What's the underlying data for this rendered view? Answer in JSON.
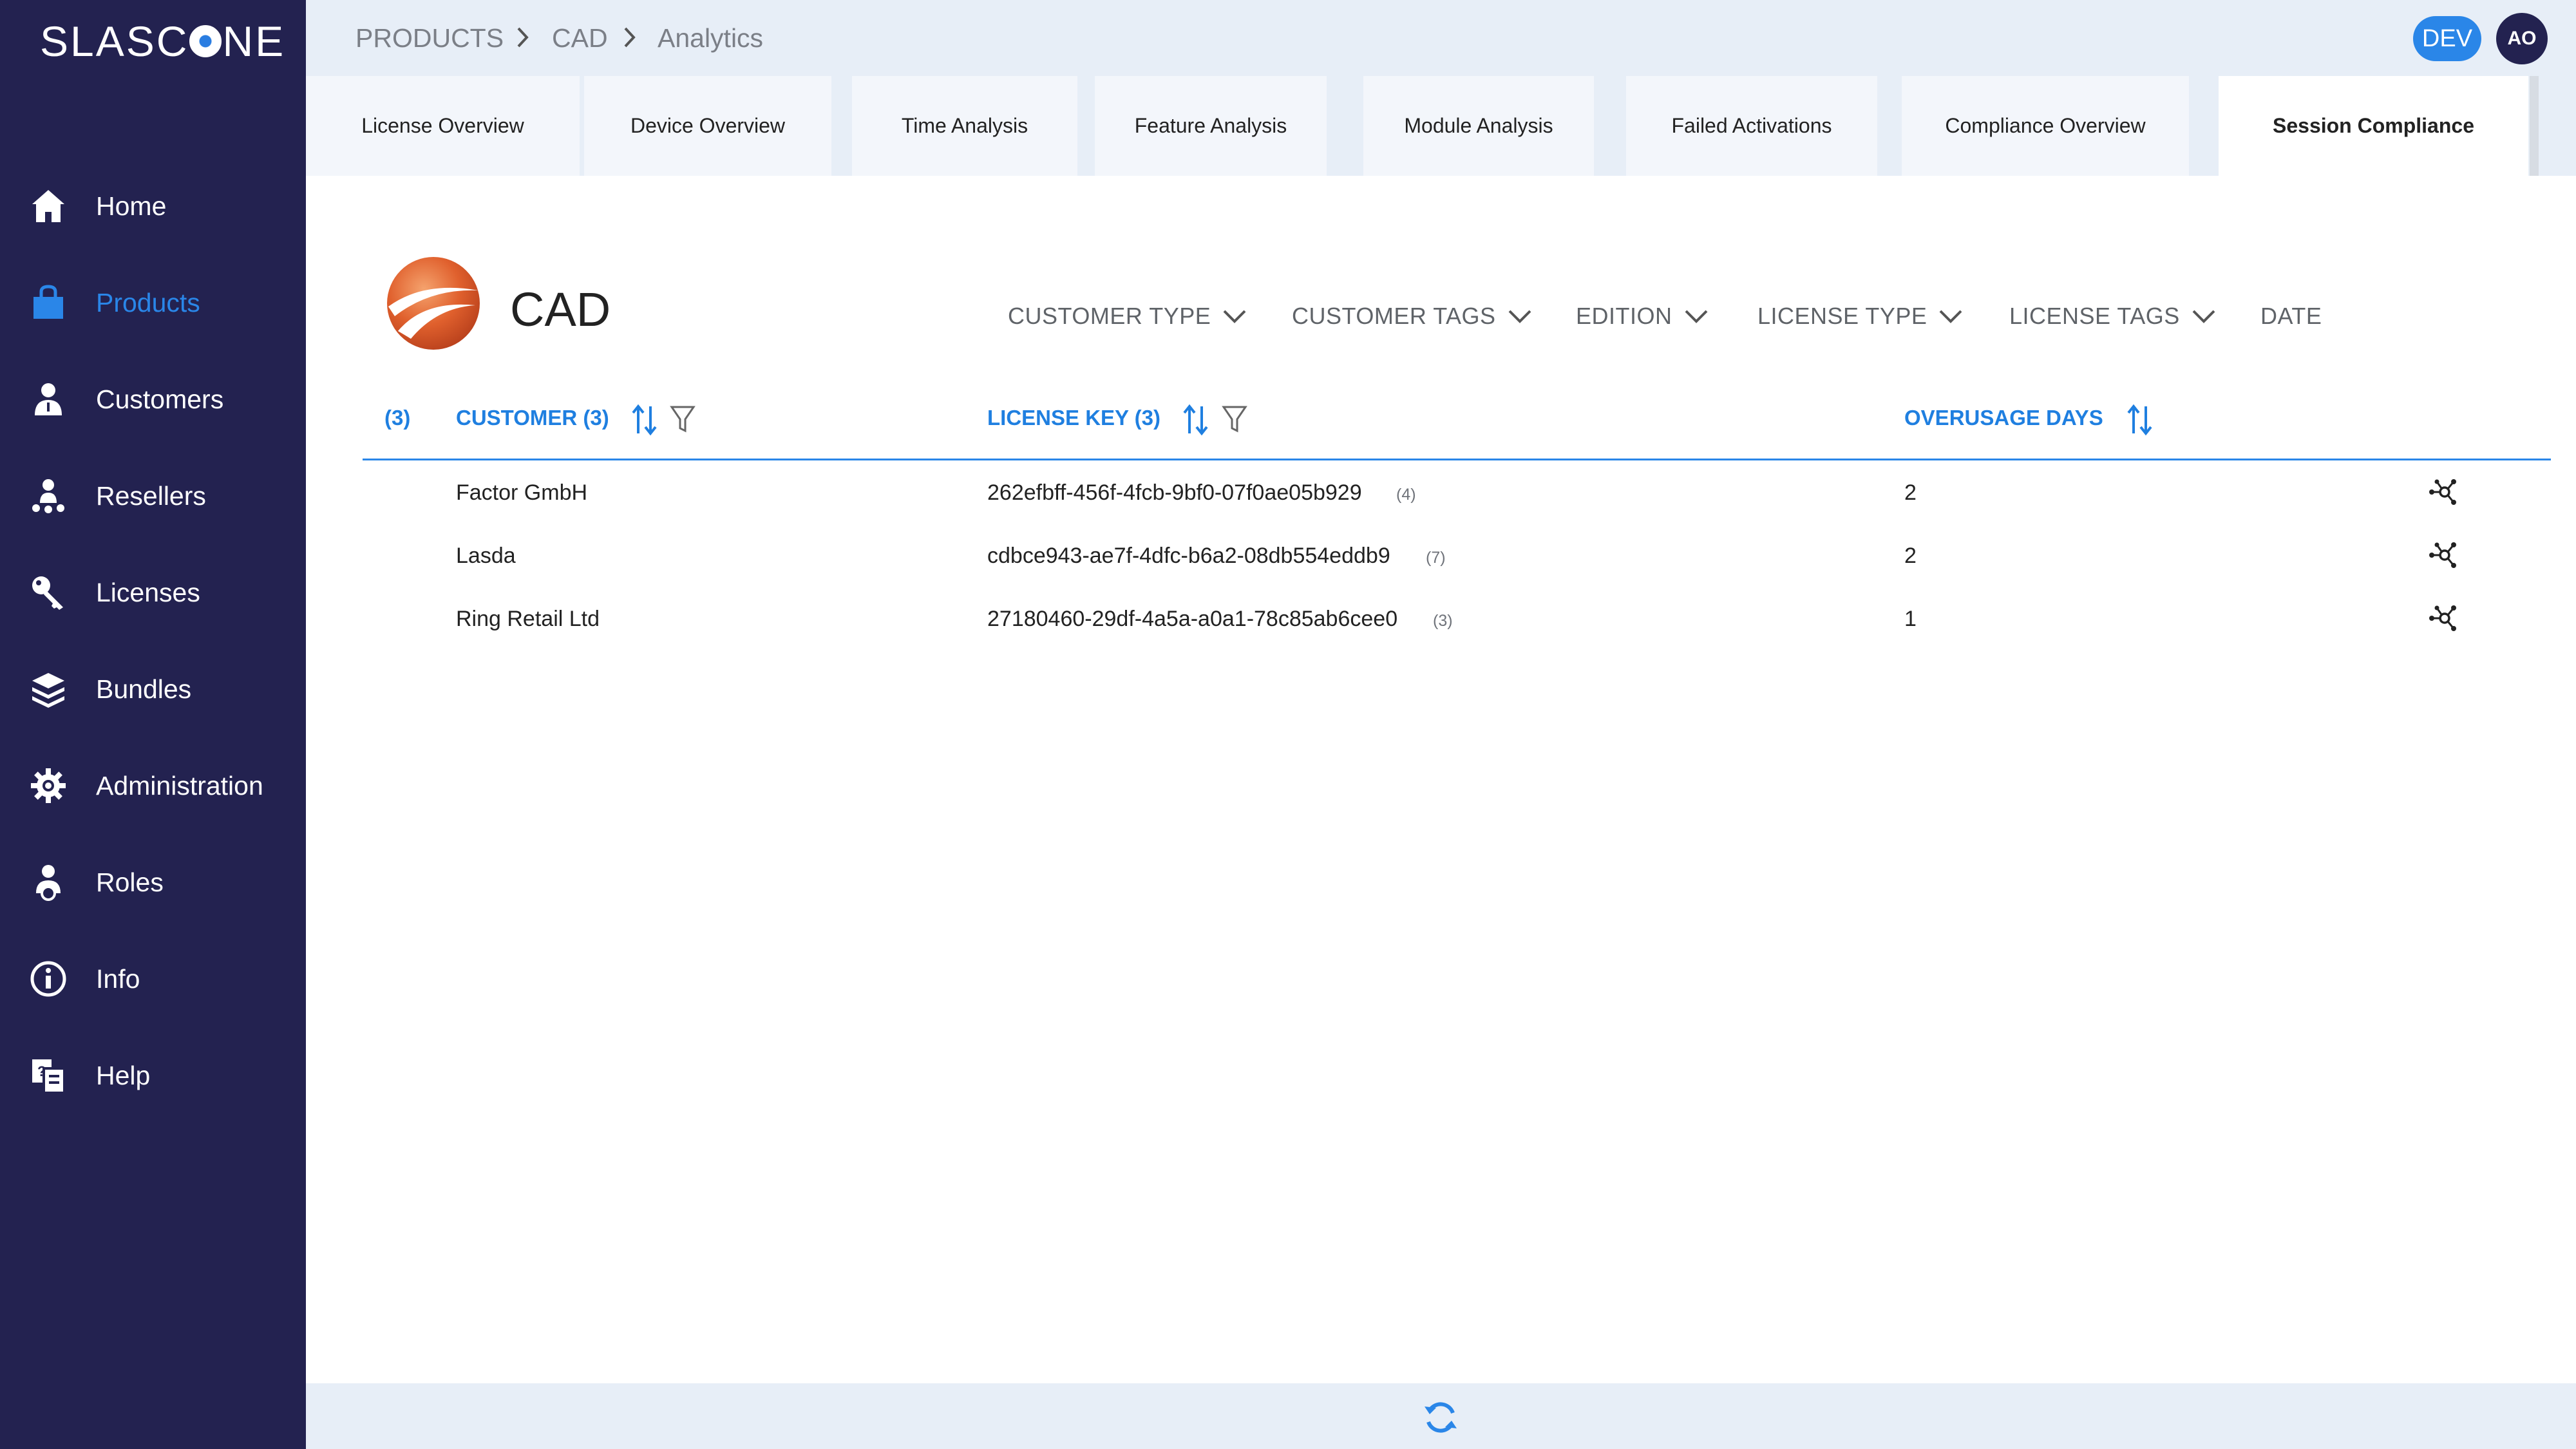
{
  "app": {
    "logo_text_left": "SLASC",
    "logo_text_right": "NE",
    "accent_color": "#2a86e8",
    "sidebar_color": "#232250"
  },
  "sidebar": {
    "items": [
      {
        "label": "Home",
        "icon": "home-icon"
      },
      {
        "label": "Products",
        "icon": "shopping-bag-icon",
        "active": true
      },
      {
        "label": "Customers",
        "icon": "customer-icon"
      },
      {
        "label": "Resellers",
        "icon": "reseller-icon"
      },
      {
        "label": "Licenses",
        "icon": "key-icon"
      },
      {
        "label": "Bundles",
        "icon": "bundles-icon"
      },
      {
        "label": "Administration",
        "icon": "gear-icon"
      },
      {
        "label": "Roles",
        "icon": "roles-icon"
      },
      {
        "label": "Info",
        "icon": "info-icon"
      },
      {
        "label": "Help",
        "icon": "help-icon"
      }
    ]
  },
  "breadcrumb": [
    "PRODUCTS",
    "CAD",
    "Analytics"
  ],
  "header": {
    "env_badge": "DEV",
    "avatar_initials": "AO"
  },
  "tabs": [
    {
      "label": "License Overview"
    },
    {
      "label": "Device Overview"
    },
    {
      "label": "Time Analysis"
    },
    {
      "label": "Feature Analysis"
    },
    {
      "label": "Module Analysis"
    },
    {
      "label": "Failed Activations"
    },
    {
      "label": "Compliance Overview"
    },
    {
      "label": "Session Compliance",
      "active": true
    }
  ],
  "product": {
    "title": "CAD"
  },
  "filters": [
    "CUSTOMER TYPE",
    "CUSTOMER TAGS",
    "EDITION",
    "LICENSE TYPE",
    "LICENSE TAGS",
    "DATE"
  ],
  "table": {
    "row_count": "(3)",
    "columns": {
      "customer": "CUSTOMER (3)",
      "license_key": "LICENSE KEY (3)",
      "overusage_days": "OVERUSAGE DAYS"
    },
    "rows": [
      {
        "customer": "Factor GmbH",
        "license_key": "262efbff-456f-4fcb-9bf0-07f0ae05b929",
        "count": "(4)",
        "overusage_days": "2"
      },
      {
        "customer": "Lasda",
        "license_key": "cdbce943-ae7f-4dfc-b6a2-08db554eddb9",
        "count": "(7)",
        "overusage_days": "2"
      },
      {
        "customer": "Ring Retail Ltd",
        "license_key": "27180460-29df-4a5a-a0a1-78c85ab6cee0",
        "count": "(3)",
        "overusage_days": "1"
      }
    ]
  }
}
